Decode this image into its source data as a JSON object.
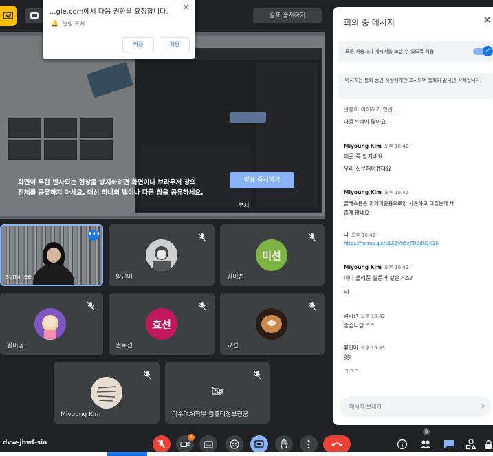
{
  "permission_popup": {
    "title": "...gle.com에서 다음 권한을 요청합니다.",
    "item": "알림 표시",
    "allow_label": "허용",
    "deny_label": "차단"
  },
  "top_bar": {
    "stop_presenting_label": "발표 중지하기"
  },
  "presentation": {
    "warning_line1": "화면이 무한 반사되는 현상을 방지하려면 화면이나 브라우저 창의",
    "warning_line2": "전체를 공유하지 마세요. 대신 하나의 탭이나 다른 창을 공유하세요.",
    "stop_button_label": "발표 중지하기",
    "ignore_label": "무시"
  },
  "tiles": [
    {
      "name": "sumi lee",
      "initials": ""
    },
    {
      "name": "황인미",
      "initials": ""
    },
    {
      "name": "김미선",
      "initials": "미선"
    },
    {
      "name": "김미영",
      "initials": ""
    },
    {
      "name": "권효선",
      "initials": "효선"
    },
    {
      "name": "요선",
      "initials": ""
    },
    {
      "name": "Miyoung Kim",
      "initials": ""
    },
    {
      "name": "이수여AI학부 컴퓨터정보전공",
      "initials": ""
    }
  ],
  "bottom_bar": {
    "meeting_code": "dvw-jbwf-sio",
    "notification_count": "1",
    "people_count": "8"
  },
  "chat": {
    "title": "회의 중 메시지",
    "toggle_label": "모든 사용자가 메시지를 보낼 수 있도록 허용",
    "toggle_on": true,
    "notice": "메시지는 통화 중인 사람에게만 표시되며 통화가 끝나면 삭제됩니다.",
    "input_placeholder": "메시지 보내기",
    "messages": [
      {
        "sender": "",
        "time": "",
        "text": "알봉어 이해하기 인갈..."
      },
      {
        "sender": "",
        "time": "",
        "text": "다중선택이 많아요"
      },
      {
        "sender": "Miyoung Kim",
        "time": "오후 10:42",
        "text": ""
      },
      {
        "sender": "",
        "time": "",
        "text": "이곳 쪽 잡기네요"
      },
      {
        "sender": "",
        "time": "",
        "text": "우리 실문해야겠다요"
      },
      {
        "sender": "Miyoung Kim",
        "time": "오후 10:42",
        "text": "클래스룸은 과제제출용으로만 사용하고 그렇는데 배"
      },
      {
        "sender": "",
        "time": "",
        "text": "출게 많네요~"
      },
      {
        "sender": "나",
        "time": "오후 10:42",
        "text": ""
      },
      {
        "sender": "",
        "time": "",
        "text": "https://forms.gle/k1X5Vb5ePD8dU1K16"
      },
      {
        "sender": "Miyoung Kim",
        "time": "오후 10:42",
        "text": ""
      },
      {
        "sender": "",
        "time": "",
        "text": "이따 올려준 설문과 같은거죠?"
      },
      {
        "sender": "",
        "time": "",
        "text": "네~"
      },
      {
        "sender": "김미선",
        "time": "오후 10:42",
        "text": ""
      },
      {
        "sender": "",
        "time": "",
        "text": "좋습니당 ^^"
      },
      {
        "sender": "황인미",
        "time": "오후 10:43",
        "text": ""
      },
      {
        "sender": "",
        "time": "",
        "text": "헷!"
      },
      {
        "sender": "",
        "time": "",
        "text": "ㅋㅋㅋ"
      }
    ]
  }
}
